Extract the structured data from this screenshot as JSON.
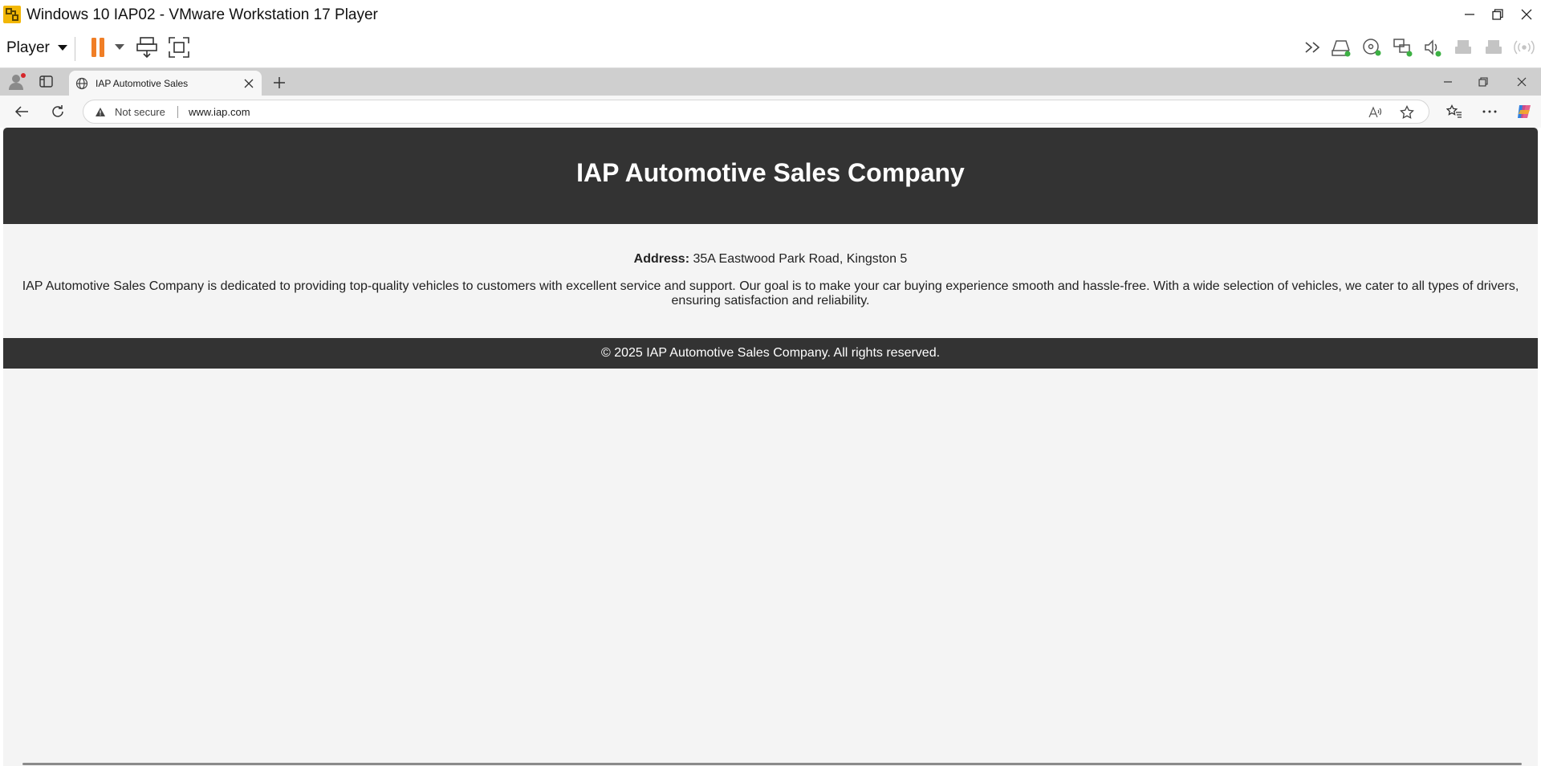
{
  "vmware": {
    "window_title": "Windows 10 IAP02 - VMware Workstation 17 Player",
    "menu_label": "Player",
    "icons": [
      "vmware-logo-icon",
      "pause-icon",
      "dropdown-icon",
      "send-ctrl-alt-del-icon",
      "fullscreen-icon",
      "more-devices-icon",
      "hard-disk-icon",
      "cd-dvd-icon",
      "network-adapter-icon",
      "sound-card-icon",
      "usb-printer-icon",
      "usb-device-icon",
      "wireless-icon"
    ],
    "colors": {
      "pause": "#f07e26",
      "device_active": "#3cb043"
    }
  },
  "browser": {
    "tab_title": "IAP Automotive Sales",
    "security_label": "Not secure",
    "url": "www.iap.com"
  },
  "site": {
    "title": "IAP Automotive Sales Company",
    "address_label": "Address:",
    "address_value": "35A Eastwood Park Road, Kingston 5",
    "description": "IAP Automotive Sales Company is dedicated to providing top-quality vehicles to customers with excellent service and support. Our goal is to make your car buying experience smooth and hassle-free. With a wide selection of vehicles, we cater to all types of drivers, ensuring satisfaction and reliability.",
    "footer": "© 2025 IAP Automotive Sales Company. All rights reserved.",
    "colors": {
      "header_bg": "#333333",
      "page_bg": "#f4f4f4"
    }
  }
}
